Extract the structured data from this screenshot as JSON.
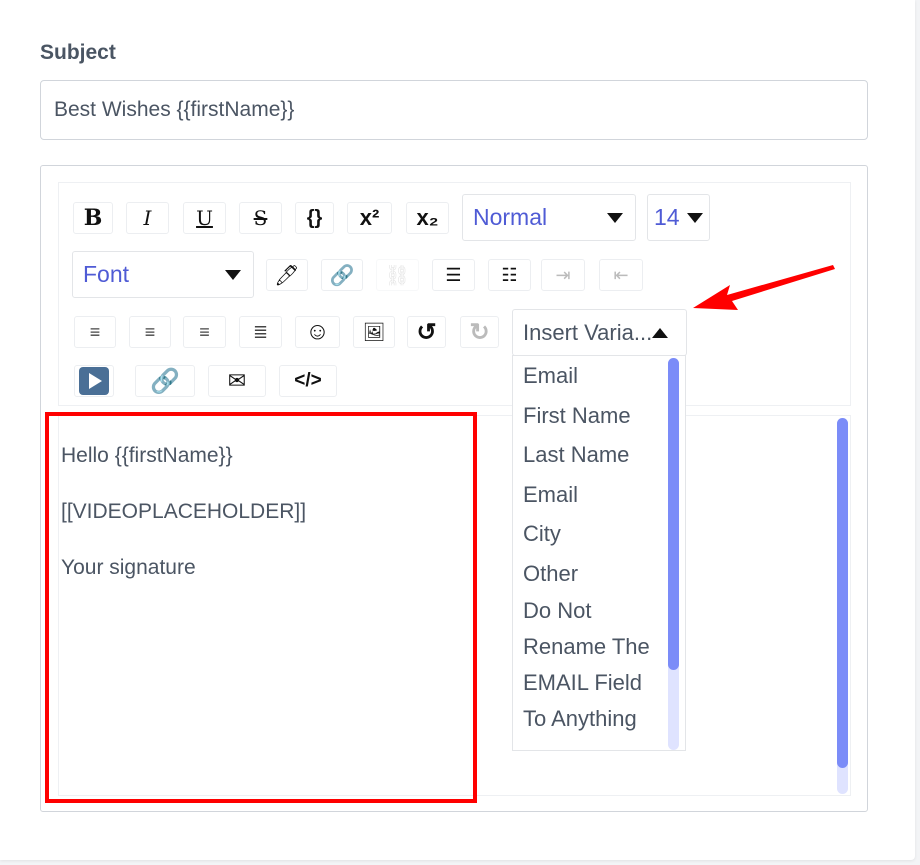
{
  "subject": {
    "label": "Subject",
    "value": "Best Wishes {{firstName}}"
  },
  "toolbar": {
    "bold": "B",
    "italic": "I",
    "underline": "U",
    "strike": "S",
    "code_block": "{}",
    "superscript": "x²",
    "subscript": "x₂",
    "heading_select": "Normal",
    "size_select": "14",
    "font_select": "Font",
    "insert_variable": "Insert Varia..."
  },
  "variables": [
    "Email",
    "First Name",
    "Last Name",
    "Email",
    "City",
    "Other",
    "Do Not Rename The EMAIL Field To Anything"
  ],
  "body": {
    "line1": "Hello {{firstName}}",
    "line2": "[[VIDEOPLACEHOLDER]]",
    "line3": "Your signature"
  },
  "colors": {
    "accent": "#4f5bd5",
    "annotation": "#ff0000",
    "scrollbar": "#7b8cf8"
  }
}
